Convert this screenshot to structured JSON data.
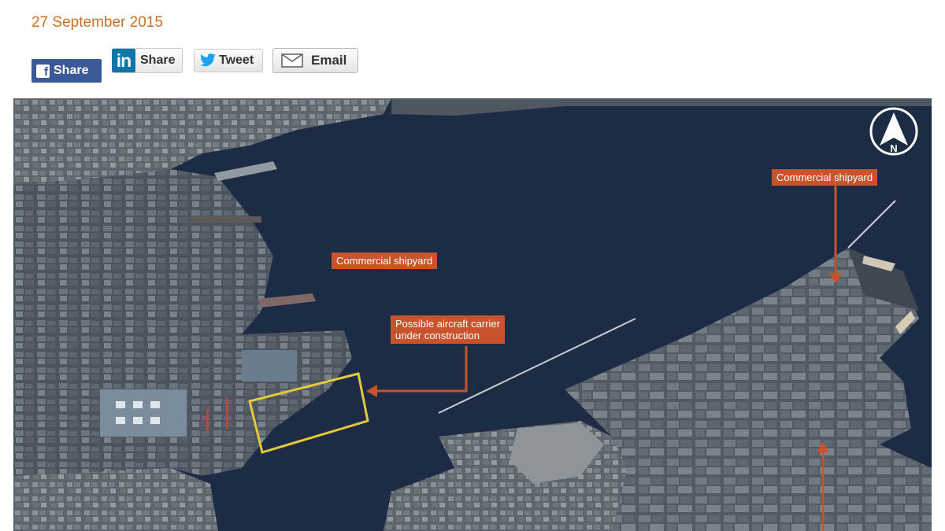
{
  "article": {
    "date": "27 September 2015"
  },
  "share": {
    "facebook_label": "Share",
    "linkedin_label": "Share",
    "twitter_label": "Tweet",
    "email_label": "Email"
  },
  "map": {
    "compass_letter": "N",
    "labels": {
      "commercial_shipyard_center": "Commercial shipyard",
      "commercial_shipyard_right": "Commercial shipyard",
      "carrier_line1": "Possible aircraft carrier",
      "carrier_line2": "under construction"
    },
    "colors": {
      "label_bg": "#c9532c",
      "highlight_box": "#e6c93a",
      "water": "#1b2a41"
    }
  },
  "icons": [
    "facebook-icon",
    "linkedin-icon",
    "twitter-icon",
    "email-icon",
    "north-arrow-icon"
  ]
}
